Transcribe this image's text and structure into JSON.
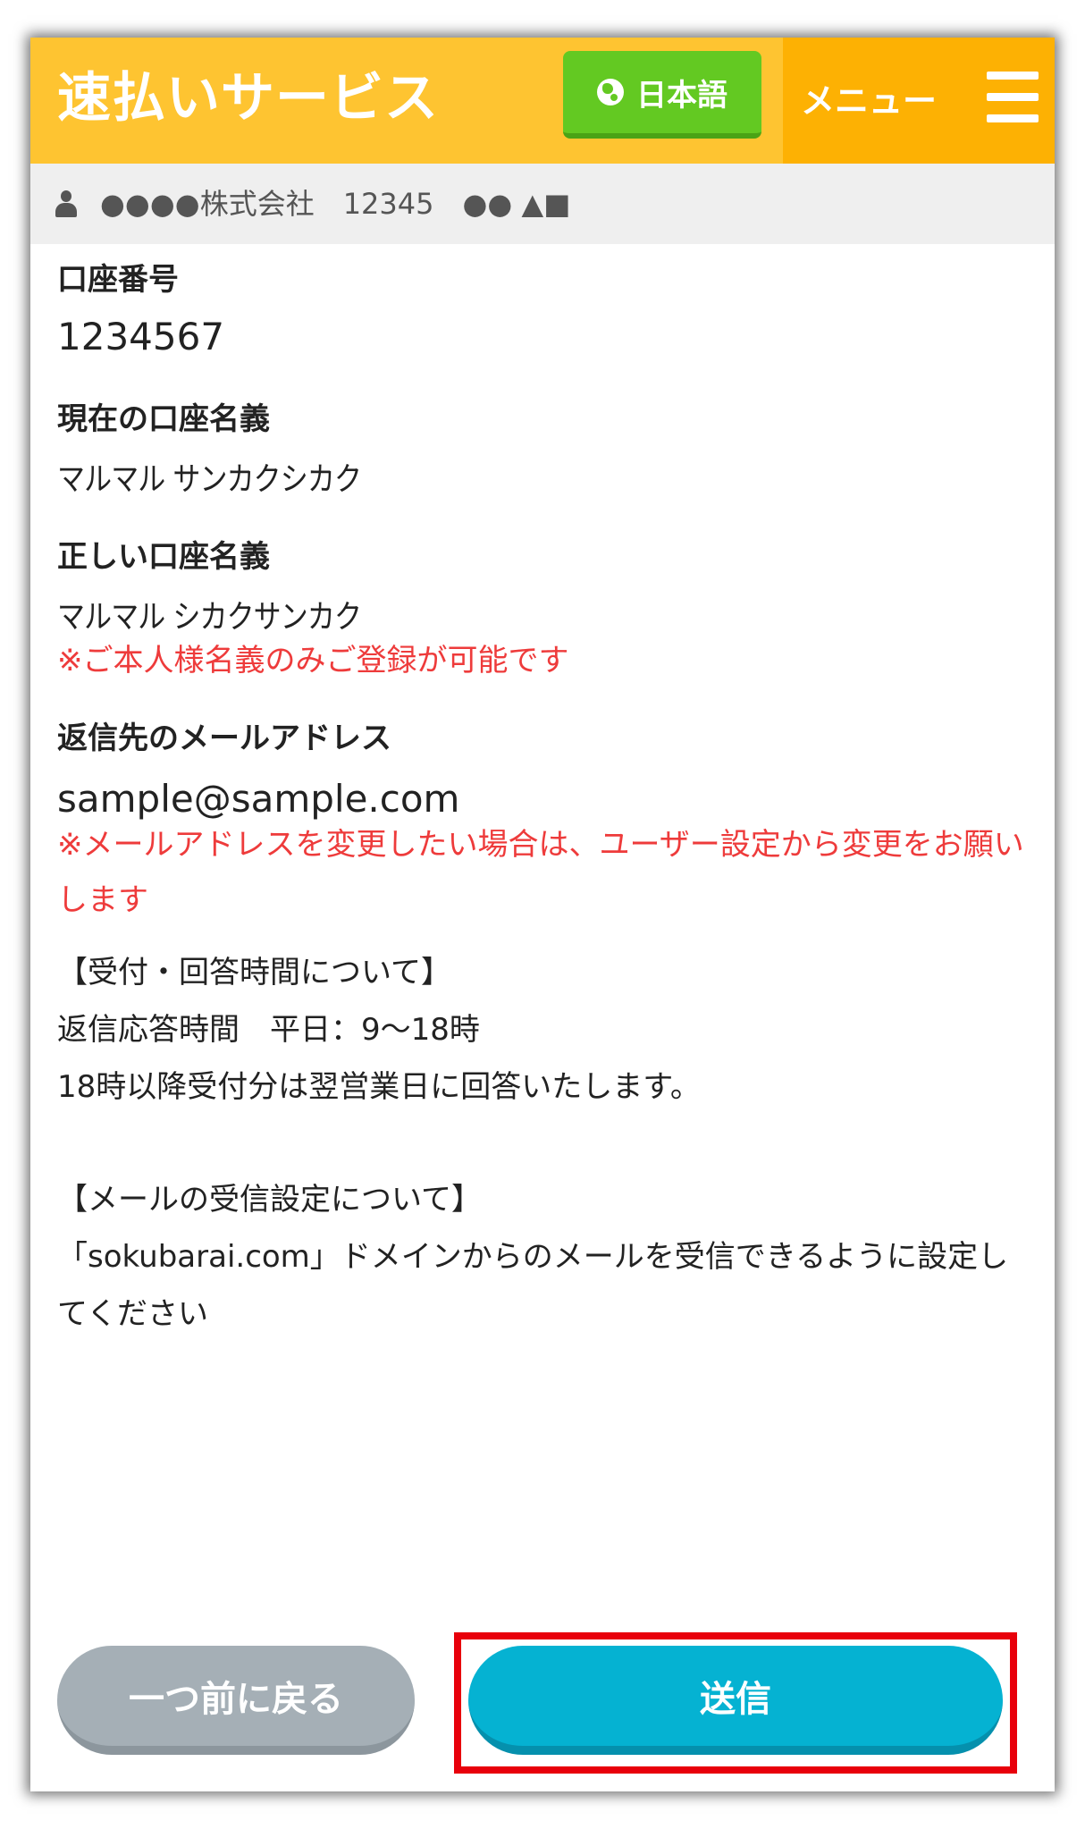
{
  "header": {
    "title": "速払いサービス",
    "language_button": "日本語",
    "menu_label": "メニュー"
  },
  "userbar": {
    "text": "●●●●株式会社　12345　●● ▲■"
  },
  "form": {
    "account_number_label": "口座番号",
    "account_number_value": "1234567",
    "current_name_label": "現在の口座名義",
    "current_name_value": "マルマル サンカクシカク",
    "correct_name_label": "正しい口座名義",
    "correct_name_value": "マルマル シカクサンカク",
    "correct_name_note": "※ご本人様名義のみご登録が可能です",
    "reply_email_label": "返信先のメールアドレス",
    "reply_email_value": "sample@sample.com",
    "reply_email_note": "※メールアドレスを変更したい場合は、ユーザー設定から変更をお願いします"
  },
  "info": {
    "hours_block": "【受付・回答時間について】\n返信応答時間　平日：9〜18時\n18時以降受付分は翌営業日に回答いたします。",
    "mail_block": "【メールの受信設定について】\n「sokubarai.com」ドメインからのメールを受信できるように設定してください"
  },
  "buttons": {
    "back_label": "一つ前に戻る",
    "send_label": "送信"
  },
  "colors": {
    "header": "#fec431",
    "menu_bg": "#fdb103",
    "language_button": "#63c922",
    "note_red": "#ee3b3b",
    "send_button": "#05b2d2",
    "back_button": "#a5afb6",
    "highlight": "#e8000b"
  }
}
